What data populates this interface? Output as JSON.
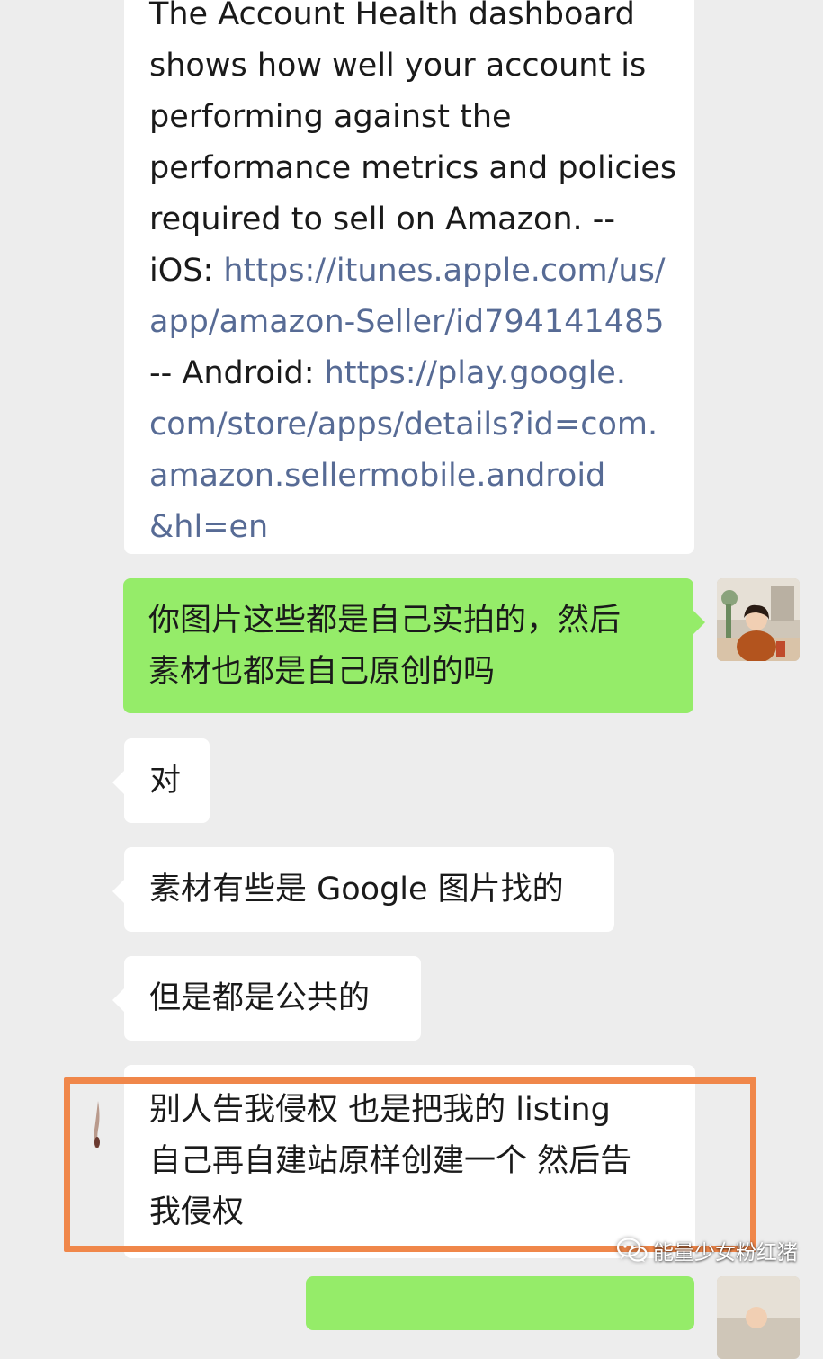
{
  "messages": {
    "english": {
      "lines": [
        "The Account Health dashboard",
        "shows how well your account is",
        "performing against the",
        "performance metrics and policies",
        "required to sell on Amazon.  --"
      ],
      "ios_label": "iOS: ",
      "ios_link": [
        "https://itunes.apple.com/us/",
        "app/amazon-Seller/id794141485"
      ],
      "android_label": "-- Android: ",
      "android_link": [
        "https://play.google.",
        "com/store/apps/details?id=com.",
        "amazon.sellermobile.android",
        "&hl=en"
      ]
    },
    "green_1": [
      "你图片这些都是自己实拍的，然后",
      "素材也都是自己原创的吗"
    ],
    "dui": "对",
    "google": "素材有些是 Google 图片找的",
    "public": "但是都是公共的",
    "infringe": [
      "别人告我侵权 也是把我的 listing",
      "自己再自建站原样创建一个 然后告",
      "我侵权"
    ]
  },
  "watermark": {
    "text": "能量少女粉红猪",
    "icon": "wechat-icon"
  },
  "colors": {
    "background": "#ededed",
    "incoming_bubble": "#ffffff",
    "outgoing_bubble": "#95ec69",
    "link": "#576b95",
    "highlight_border": "#f0874a"
  }
}
